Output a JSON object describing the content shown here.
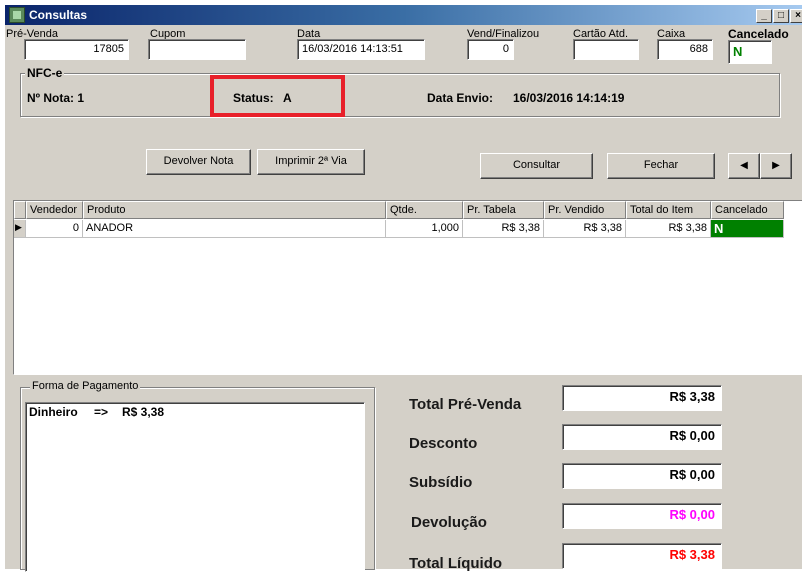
{
  "window": {
    "title": "Consultas",
    "min_glyph": "_",
    "max_glyph": "□",
    "close_glyph": "×"
  },
  "header": {
    "pre_venda_label": "Pré-Venda",
    "pre_venda_value": "17805",
    "cupom_label": "Cupom",
    "cupom_value": "",
    "data_label": "Data",
    "data_value": "16/03/2016 14:13:51",
    "vend_label": "Vend/Finalizou",
    "vend_value": "0",
    "cartao_label": "Cartão Atd.",
    "cartao_value": "",
    "caixa_label": "Caixa",
    "caixa_value": "688",
    "cancelado_label": "Cancelado",
    "cancelado_value": "N"
  },
  "nfce": {
    "group_title": "NFC-e",
    "nota_label": "Nº Nota: 1",
    "status_label": "Status:",
    "status_value": "A",
    "envio_label": "Data Envio:",
    "envio_value": "16/03/2016 14:14:19"
  },
  "buttons": {
    "devolver": "Devolver Nota",
    "imprimir": "Imprimir 2ª Via",
    "consultar": "Consultar",
    "fechar": "Fechar",
    "prev": "◀",
    "next": "▶"
  },
  "grid": {
    "columns": [
      "Vendedor",
      "Produto",
      "Qtde.",
      "Pr. Tabela",
      "Pr. Vendido",
      "Total do Item",
      "Cancelado"
    ],
    "rows": [
      {
        "indicator": "▶",
        "vendedor": "0",
        "produto": "ANADOR",
        "qtde": "1,000",
        "pr_tabela": "R$ 3,38",
        "pr_vendido": "R$ 3,38",
        "total_item": "R$ 3,38",
        "cancelado": "N"
      }
    ]
  },
  "payment": {
    "group_title": "Forma de Pagamento",
    "method": "Dinheiro",
    "arrow": "=>",
    "amount": "R$ 3,38"
  },
  "totals": {
    "pre_venda_label": "Total Pré-Venda",
    "pre_venda_value": "R$ 3,38",
    "desconto_label": "Desconto",
    "desconto_value": "R$ 0,00",
    "subsidio_label": "Subsídio",
    "subsidio_value": "R$ 0,00",
    "devolucao_label": "Devolução",
    "devolucao_value": "R$ 0,00",
    "liquido_label": "Total Líquido",
    "liquido_value": "R$ 3,38"
  },
  "colors": {
    "cancelado_bg": "#008000",
    "cancelado_text": "#ffffff",
    "highlight_box": "#e8202a",
    "devolucao_value": "#ff00ff",
    "liquido_value": "#ff0000"
  }
}
